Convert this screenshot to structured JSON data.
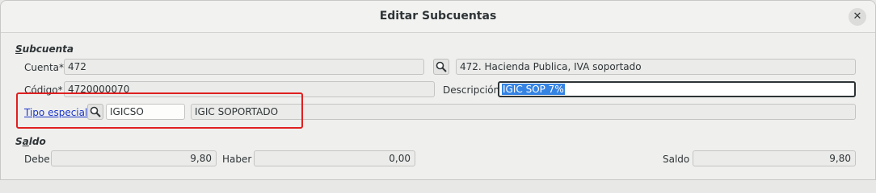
{
  "dialog": {
    "title": "Editar Subcuentas",
    "close_symbol": "✕"
  },
  "subcuenta": {
    "section_label_first": "S",
    "section_label_rest": "ubcuenta",
    "cuenta_label": "Cuenta*",
    "cuenta_value": "472",
    "cuenta_search_icon": "search-icon",
    "cuenta_description": "472. Hacienda Publica, IVA soportado",
    "codigo_label": "Código*",
    "codigo_value": "4720000070",
    "descripcion_label": "Descripción",
    "descripcion_value": "IGIC SOP 7%",
    "tipo_especial_label": "Tipo especial",
    "tipo_especial_search_icon": "search-icon",
    "tipo_especial_code": "IGICSO",
    "tipo_especial_description": "IGIC SOPORTADO"
  },
  "saldo": {
    "section_label_first": "S",
    "section_label_mid": "a",
    "section_label_rest": "ldo",
    "debe_label": "Debe",
    "debe_value": "9,80",
    "haber_label": "Haber",
    "haber_value": "0,00",
    "saldo_label": "Saldo",
    "saldo_value": "9,80"
  },
  "colors": {
    "highlight_border": "#e02020",
    "selection": "#3584e4",
    "link": "#1a35c9"
  }
}
